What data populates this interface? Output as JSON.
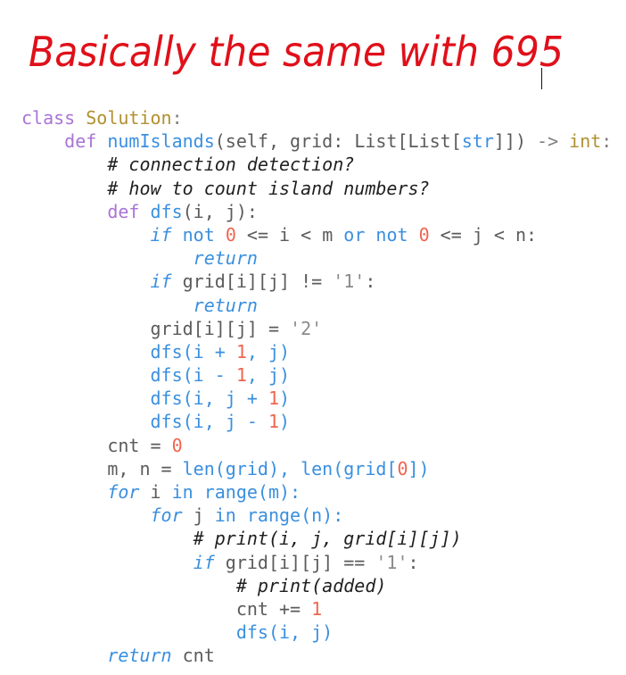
{
  "note": {
    "text": "Basically the same with 695",
    "color": "#e0101a"
  },
  "editor": {
    "lines": [
      [
        {
          "t": "class ",
          "c": "kw"
        },
        {
          "t": "Solution",
          "c": "cls"
        },
        {
          "t": ":",
          "c": "op"
        }
      ],
      [
        {
          "t": "    ",
          "c": "pl"
        },
        {
          "t": "def ",
          "c": "kw"
        },
        {
          "t": "numIslands",
          "c": "fn"
        },
        {
          "t": "(self, grid: ",
          "c": "pl"
        },
        {
          "t": "List",
          "c": "pl"
        },
        {
          "t": "[",
          "c": "pl"
        },
        {
          "t": "List",
          "c": "pl"
        },
        {
          "t": "[",
          "c": "pl"
        },
        {
          "t": "str",
          "c": "fn"
        },
        {
          "t": "]]) ",
          "c": "pl"
        },
        {
          "t": "-> ",
          "c": "op"
        },
        {
          "t": "int",
          "c": "cls"
        },
        {
          "t": ":",
          "c": "op"
        }
      ],
      [
        {
          "t": "        ",
          "c": "pl"
        },
        {
          "t": "# connection detection?",
          "c": "cm"
        }
      ],
      [
        {
          "t": "        ",
          "c": "pl"
        },
        {
          "t": "# how to count island numbers?",
          "c": "cm"
        }
      ],
      [
        {
          "t": "        ",
          "c": "pl"
        },
        {
          "t": "def ",
          "c": "kw"
        },
        {
          "t": "dfs",
          "c": "fn"
        },
        {
          "t": "(i, j):",
          "c": "pl"
        }
      ],
      [
        {
          "t": "            ",
          "c": "pl"
        },
        {
          "t": "if",
          "c": "it"
        },
        {
          "t": " not ",
          "c": "fn"
        },
        {
          "t": "0",
          "c": "num"
        },
        {
          "t": " <= i < m ",
          "c": "pl"
        },
        {
          "t": "or not ",
          "c": "fn"
        },
        {
          "t": "0",
          "c": "num"
        },
        {
          "t": " <= j < n:",
          "c": "pl"
        }
      ],
      [
        {
          "t": "                ",
          "c": "pl"
        },
        {
          "t": "return",
          "c": "it"
        }
      ],
      [
        {
          "t": "            ",
          "c": "pl"
        },
        {
          "t": "if",
          "c": "it"
        },
        {
          "t": " grid[i][j] != ",
          "c": "pl"
        },
        {
          "t": "'1'",
          "c": "str"
        },
        {
          "t": ":",
          "c": "pl"
        }
      ],
      [
        {
          "t": "                ",
          "c": "pl"
        },
        {
          "t": "return",
          "c": "it"
        }
      ],
      [
        {
          "t": "            ",
          "c": "pl"
        },
        {
          "t": "grid[i][j] = ",
          "c": "pl"
        },
        {
          "t": "'2'",
          "c": "str"
        }
      ],
      [
        {
          "t": "            ",
          "c": "pl"
        },
        {
          "t": "dfs",
          "c": "fn"
        },
        {
          "t": "(i + ",
          "c": "fn"
        },
        {
          "t": "1",
          "c": "num"
        },
        {
          "t": ", j)",
          "c": "fn"
        }
      ],
      [
        {
          "t": "            ",
          "c": "pl"
        },
        {
          "t": "dfs",
          "c": "fn"
        },
        {
          "t": "(i - ",
          "c": "fn"
        },
        {
          "t": "1",
          "c": "num"
        },
        {
          "t": ", j)",
          "c": "fn"
        }
      ],
      [
        {
          "t": "            ",
          "c": "pl"
        },
        {
          "t": "dfs",
          "c": "fn"
        },
        {
          "t": "(i, j + ",
          "c": "fn"
        },
        {
          "t": "1",
          "c": "num"
        },
        {
          "t": ")",
          "c": "fn"
        }
      ],
      [
        {
          "t": "            ",
          "c": "pl"
        },
        {
          "t": "dfs",
          "c": "fn"
        },
        {
          "t": "(i, j - ",
          "c": "fn"
        },
        {
          "t": "1",
          "c": "num"
        },
        {
          "t": ")",
          "c": "fn"
        }
      ],
      [
        {
          "t": "        ",
          "c": "pl"
        },
        {
          "t": "cnt = ",
          "c": "pl"
        },
        {
          "t": "0",
          "c": "num"
        }
      ],
      [
        {
          "t": "        ",
          "c": "pl"
        },
        {
          "t": "m, n = ",
          "c": "pl"
        },
        {
          "t": "len",
          "c": "fn"
        },
        {
          "t": "(grid), ",
          "c": "fn"
        },
        {
          "t": "len",
          "c": "fn"
        },
        {
          "t": "(grid[",
          "c": "fn"
        },
        {
          "t": "0",
          "c": "num"
        },
        {
          "t": "])",
          "c": "fn"
        }
      ],
      [
        {
          "t": "        ",
          "c": "pl"
        },
        {
          "t": "for",
          "c": "it"
        },
        {
          "t": " i ",
          "c": "pl"
        },
        {
          "t": "in ",
          "c": "fn"
        },
        {
          "t": "range",
          "c": "fn"
        },
        {
          "t": "(m):",
          "c": "fn"
        }
      ],
      [
        {
          "t": "            ",
          "c": "pl"
        },
        {
          "t": "for",
          "c": "it"
        },
        {
          "t": " j ",
          "c": "pl"
        },
        {
          "t": "in ",
          "c": "fn"
        },
        {
          "t": "range",
          "c": "fn"
        },
        {
          "t": "(n):",
          "c": "fn"
        }
      ],
      [
        {
          "t": "                ",
          "c": "pl"
        },
        {
          "t": "# print(i, j, grid[i][j])",
          "c": "cm"
        }
      ],
      [
        {
          "t": "                ",
          "c": "pl"
        },
        {
          "t": "if",
          "c": "it"
        },
        {
          "t": " grid[i][j] == ",
          "c": "pl"
        },
        {
          "t": "'1'",
          "c": "str"
        },
        {
          "t": ":",
          "c": "pl"
        }
      ],
      [
        {
          "t": "                    ",
          "c": "pl"
        },
        {
          "t": "# print(added)",
          "c": "cm"
        }
      ],
      [
        {
          "t": "                    ",
          "c": "pl"
        },
        {
          "t": "cnt += ",
          "c": "pl"
        },
        {
          "t": "1",
          "c": "num"
        }
      ],
      [
        {
          "t": "                    ",
          "c": "pl"
        },
        {
          "t": "dfs",
          "c": "fn"
        },
        {
          "t": "(i, j)",
          "c": "fn"
        }
      ],
      [
        {
          "t": "        ",
          "c": "pl"
        },
        {
          "t": "return",
          "c": "it"
        },
        {
          "t": " cnt",
          "c": "pl"
        }
      ]
    ]
  }
}
